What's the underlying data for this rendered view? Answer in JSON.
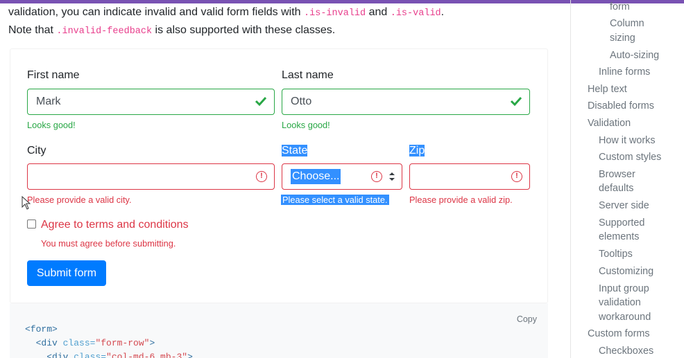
{
  "intro": {
    "line1_a": "validation, you can indicate invalid and valid form fields with ",
    "code1": ".is-invalid",
    "line1_b": " and ",
    "code2": ".is-valid",
    "line1_c": ".",
    "line2_a": "Note that ",
    "code3": ".invalid-feedback",
    "line2_b": " is also supported with these classes."
  },
  "form": {
    "first_name": {
      "label": "First name",
      "value": "Mark",
      "feedback": "Looks good!"
    },
    "last_name": {
      "label": "Last name",
      "value": "Otto",
      "feedback": "Looks good!"
    },
    "city": {
      "label": "City",
      "value": "",
      "feedback": "Please provide a valid city."
    },
    "state": {
      "label": "State",
      "value": "Choose...",
      "feedback": "Please select a valid state."
    },
    "zip": {
      "label": "Zip",
      "value": "",
      "feedback": "Please provide a valid zip."
    },
    "terms": {
      "label": "Agree to terms and conditions",
      "feedback": "You must agree before submitting.",
      "checked": false
    },
    "submit_label": "Submit form"
  },
  "code_block": {
    "copy_label": "Copy",
    "line1": "<form>",
    "line2_indent": "  ",
    "line2_tag_open": "<div ",
    "line2_attr": "class=",
    "line2_str": "\"form-row\"",
    "line2_tag_close": ">",
    "line3_indent": "    ",
    "line3_tag_open": "<div ",
    "line3_attr": "class=",
    "line3_str": "\"col-md-6 mb-3\"",
    "line3_tag_close": ">"
  },
  "toc": {
    "items": [
      "form",
      "Column",
      "sizing",
      "Auto-sizing",
      "Inline forms",
      "Help text",
      "Disabled forms",
      "Validation",
      "How it works",
      "Custom styles",
      "Browser",
      "defaults",
      "Server side",
      "Supported",
      "elements",
      "Tooltips",
      "Customizing",
      "Input group",
      "validation",
      "workaround",
      "Custom forms",
      "Checkboxes"
    ]
  },
  "colors": {
    "valid": "#28a745",
    "invalid": "#dc3545",
    "primary": "#007bff",
    "selection": "#3390ff",
    "brand_bar": "#7952b3"
  }
}
